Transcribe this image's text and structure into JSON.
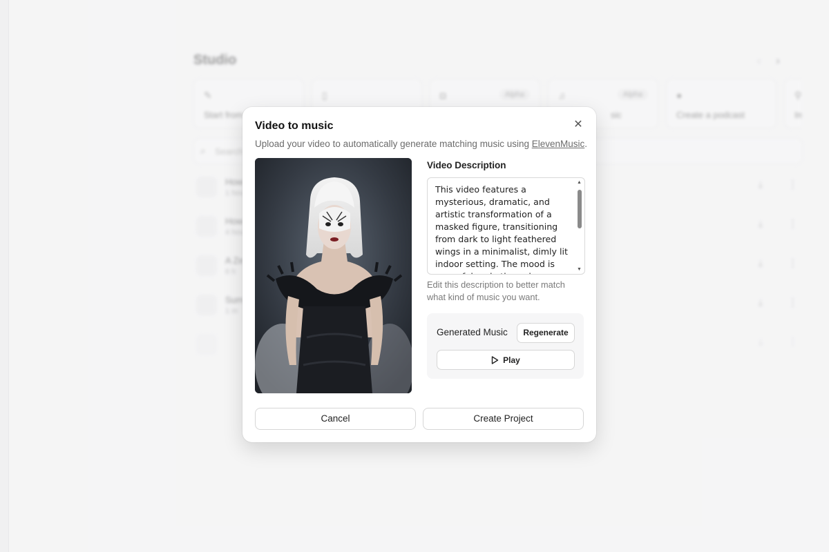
{
  "background": {
    "title": "Studio",
    "cards": [
      {
        "icon": "pencil-icon",
        "label": "Start from",
        "badge": ""
      },
      {
        "icon": "tablet-icon",
        "label": "",
        "badge": ""
      },
      {
        "icon": "video-icon",
        "label": "",
        "badge": "Alpha"
      },
      {
        "icon": "music-note-icon",
        "label": "sic",
        "badge": "Alpha"
      },
      {
        "icon": "globe-icon",
        "label": "Create a podcast",
        "badge": ""
      },
      {
        "icon": "link-icon",
        "label": "Imp",
        "badge": ""
      }
    ],
    "search_placeholder": "Search",
    "rows": [
      {
        "title": "How",
        "meta": "1 hour"
      },
      {
        "title": "How",
        "meta": "4 hour"
      },
      {
        "title": "A Ze",
        "meta": "6 h"
      },
      {
        "title": "Sum",
        "meta": "1 m"
      },
      {
        "title": "",
        "meta": ""
      }
    ]
  },
  "modal": {
    "title": "Video to music",
    "subtitle_prefix": "Upload your video to automatically generate matching music using ",
    "subtitle_link": "ElevenMusic",
    "subtitle_suffix": ".",
    "description_label": "Video Description",
    "description_text": "This video features a mysterious, dramatic, and artistic transformation of a masked figure, transitioning from dark to light feathered wings in a minimalist, dimly lit indoor setting. The mood is powerful and ethereal",
    "description_hint": "Edit this description to better match what kind of music you want.",
    "generated_music_label": "Generated Music",
    "regenerate_label": "Regenerate",
    "play_label": "Play",
    "cancel_label": "Cancel",
    "create_label": "Create Project"
  }
}
